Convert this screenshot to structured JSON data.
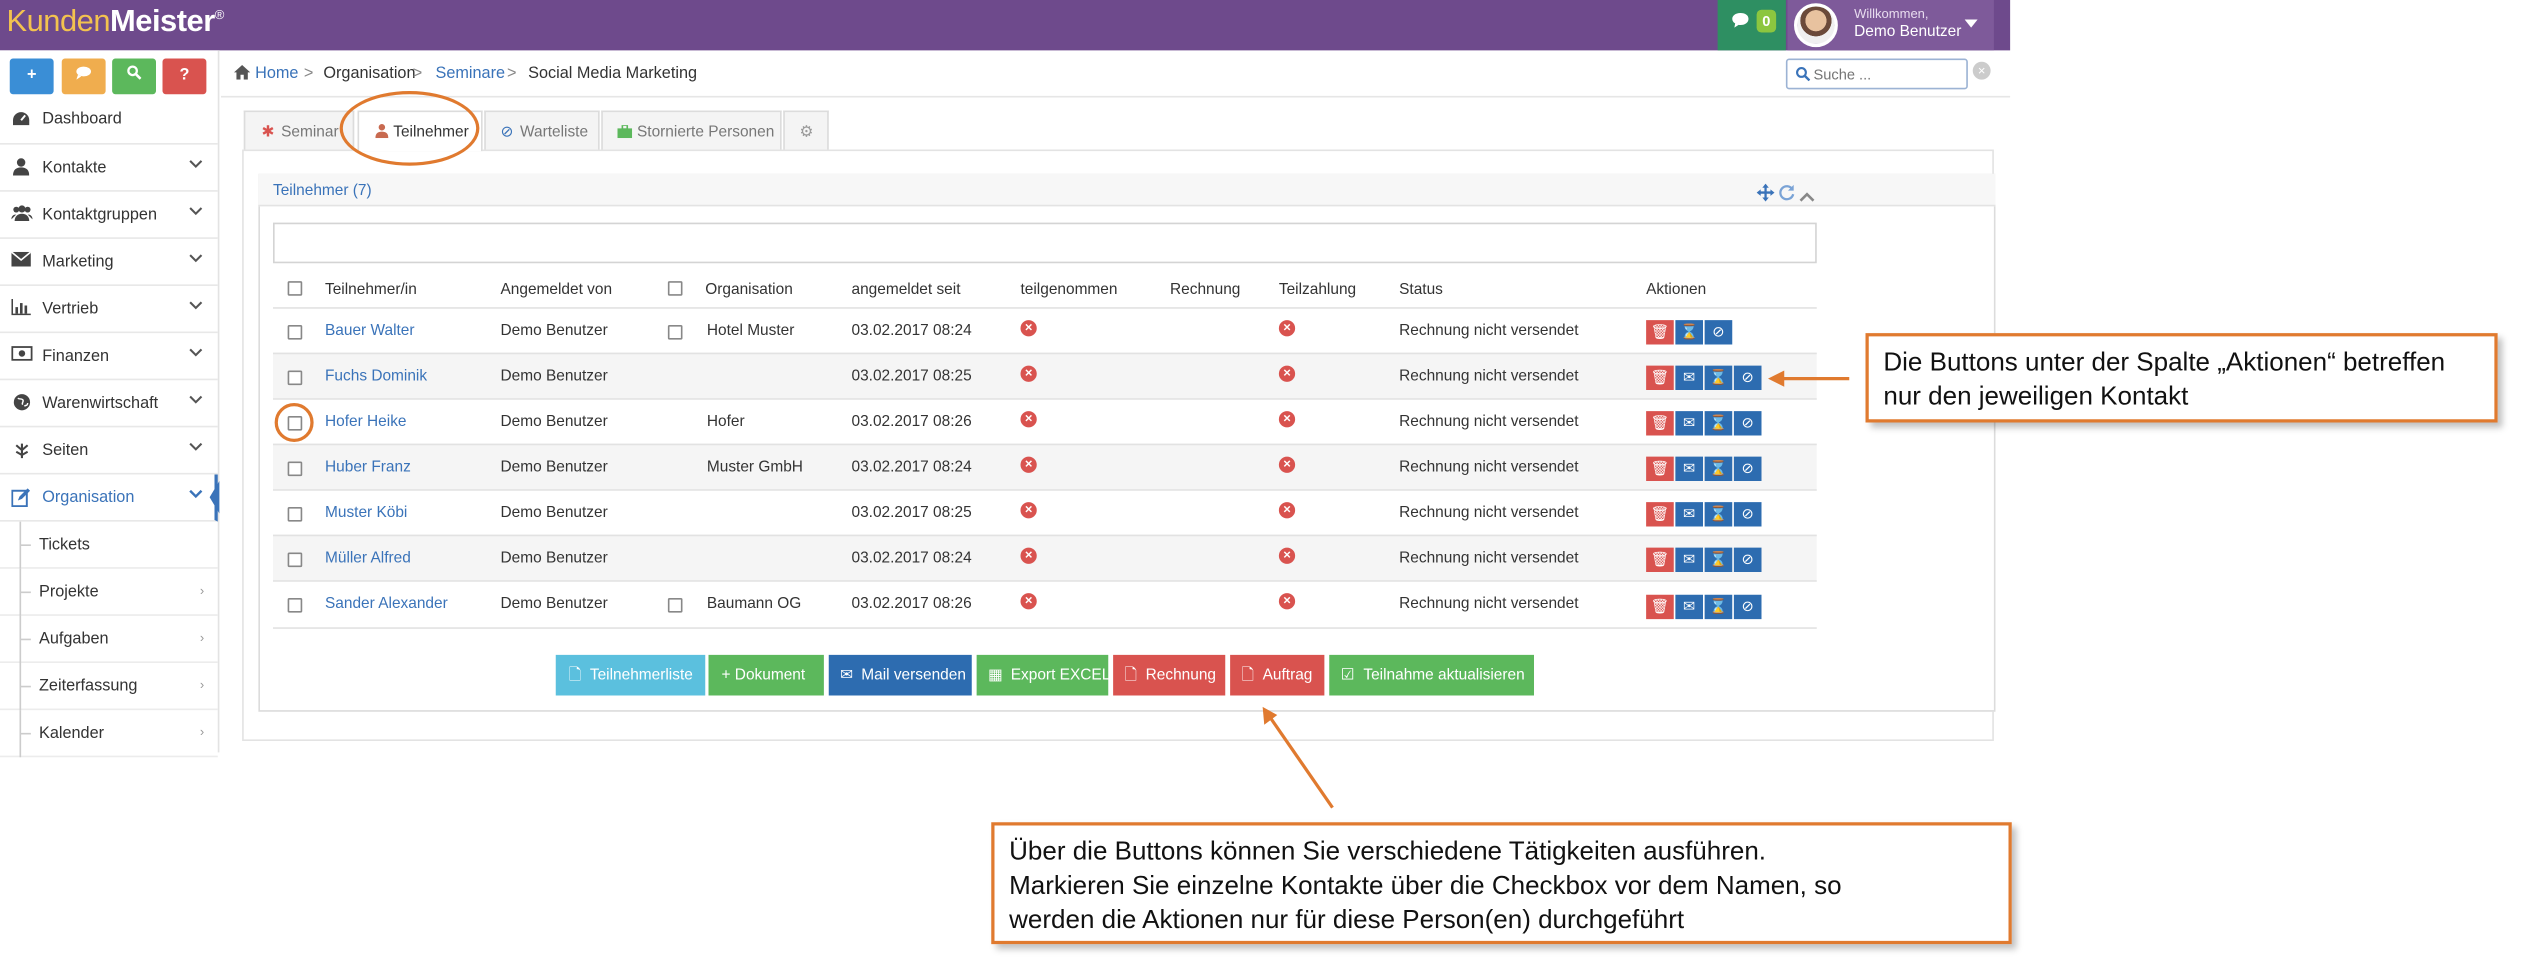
{
  "app": {
    "logo_first": "Kunden",
    "logo_second": "Meister",
    "logo_mark": "®"
  },
  "topbar": {
    "chat_count": "0",
    "welcome": "Willkommen,",
    "user_name": "Demo Benutzer"
  },
  "quick_buttons": [
    "+",
    "•",
    "Q",
    "?"
  ],
  "colors": {
    "topbar": "#6e4a8c",
    "primary": "#3a73b9",
    "danger": "#d9534f",
    "success": "#5cb85c",
    "annotation": "#e07a2f"
  },
  "sidebar": {
    "items": [
      {
        "label": "Dashboard",
        "icon": "dashboard-icon"
      },
      {
        "label": "Kontakte",
        "icon": "user-icon"
      },
      {
        "label": "Kontaktgruppen",
        "icon": "users-icon"
      },
      {
        "label": "Marketing",
        "icon": "envelope-icon"
      },
      {
        "label": "Vertrieb",
        "icon": "bar-chart-icon"
      },
      {
        "label": "Finanzen",
        "icon": "money-icon"
      },
      {
        "label": "Warenwirtschaft",
        "icon": "globe-icon"
      },
      {
        "label": "Seiten",
        "icon": "leaf-icon"
      },
      {
        "label": "Organisation",
        "icon": "edit-icon"
      }
    ],
    "subitems": [
      {
        "label": "Tickets"
      },
      {
        "label": "Projekte"
      },
      {
        "label": "Aufgaben"
      },
      {
        "label": "Zeiterfassung"
      },
      {
        "label": "Kalender"
      }
    ]
  },
  "breadcrumb": {
    "home": "Home",
    "sep": ">",
    "level1": "Organisation",
    "level2": "Seminare",
    "current": "Social Media Marketing"
  },
  "search": {
    "placeholder": "Suche ..."
  },
  "tabs": [
    {
      "label": "Seminar"
    },
    {
      "label": "Teilnehmer"
    },
    {
      "label": "Warteliste"
    },
    {
      "label": "Stornierte Personen"
    }
  ],
  "panel": {
    "title": "Teilnehmer (7)"
  },
  "table": {
    "headers": [
      "Teilnehmer/in",
      "Angemeldet von",
      "Organisation",
      "angemeldet seit",
      "teilgenommen",
      "Rechnung",
      "Teilzahlung",
      "Status",
      "Aktionen"
    ],
    "rows": [
      {
        "name": "Bauer Walter",
        "by": "Demo Benutzer",
        "org": "Hotel Muster",
        "since": "03.02.2017 08:24",
        "status": "Rechnung nicht versendet"
      },
      {
        "name": "Fuchs Dominik",
        "by": "Demo Benutzer",
        "org": "",
        "since": "03.02.2017 08:25",
        "status": "Rechnung nicht versendet"
      },
      {
        "name": "Hofer Heike",
        "by": "Demo Benutzer",
        "org": "Hofer",
        "since": "03.02.2017 08:26",
        "status": "Rechnung nicht versendet"
      },
      {
        "name": "Huber Franz",
        "by": "Demo Benutzer",
        "org": "Muster GmbH",
        "since": "03.02.2017 08:24",
        "status": "Rechnung nicht versendet"
      },
      {
        "name": "Muster Köbi",
        "by": "Demo Benutzer",
        "org": "",
        "since": "03.02.2017 08:25",
        "status": "Rechnung nicht versendet"
      },
      {
        "name": "Müller Alfred",
        "by": "Demo Benutzer",
        "org": "",
        "since": "03.02.2017 08:24",
        "status": "Rechnung nicht versendet"
      },
      {
        "name": "Sander Alexander",
        "by": "Demo Benutzer",
        "org": "Baumann OG",
        "since": "03.02.2017 08:26",
        "status": "Rechnung nicht versendet"
      }
    ]
  },
  "bottom_buttons": [
    {
      "label": "Teilnehmerliste",
      "color": "#5bc0de"
    },
    {
      "label": "+ Dokument",
      "color": "#5cb85c"
    },
    {
      "label": "Mail versenden",
      "color": "#2d6cb0"
    },
    {
      "label": "Export EXCEL",
      "color": "#5cb85c"
    },
    {
      "label": "Rechnung",
      "color": "#d9534f"
    },
    {
      "label": "Auftrag",
      "color": "#d9534f"
    },
    {
      "label": "Teilnahme aktualisieren",
      "color": "#5cb85c"
    }
  ],
  "annotations": {
    "actions_note_line1": "Die Buttons unter der Spalte „Aktionen“ betreffen",
    "actions_note_line2": "nur den jeweiligen Kontakt",
    "buttons_note_line1": "Über die Buttons können Sie verschiedene Tätigkeiten ausführen.",
    "buttons_note_line2": "Markieren Sie einzelne Kontakte über die Checkbox vor dem Namen, so",
    "buttons_note_line3": "werden die Aktionen nur für diese Person(en) durchgeführt"
  }
}
